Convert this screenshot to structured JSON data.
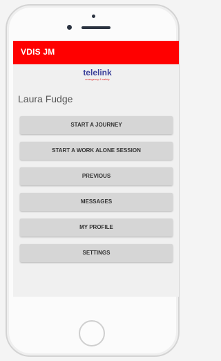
{
  "app": {
    "title": "VDIS JM"
  },
  "logo": {
    "word": "telelink",
    "tagline": "emergency & safety"
  },
  "user": {
    "name": "Laura Fudge"
  },
  "menu": {
    "items": [
      {
        "label": "START A JOURNEY"
      },
      {
        "label": "START A WORK ALONE SESSION"
      },
      {
        "label": "PREVIOUS"
      },
      {
        "label": "MESSAGES"
      },
      {
        "label": "MY PROFILE"
      },
      {
        "label": "SETTINGS"
      }
    ]
  },
  "colors": {
    "appbar": "#ff0000",
    "button": "#d6d6d6",
    "logo": "#3a3f9a"
  }
}
